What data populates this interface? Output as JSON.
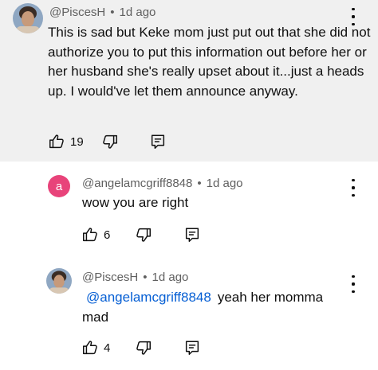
{
  "comments": [
    {
      "author": "@PiscesH",
      "time": "1d ago",
      "text": "This is sad but Keke mom just put out that she did not authorize you to put this information out before her or her husband she's really upset about it...just a heads up. I would've let them announce anyway.",
      "likes": "19",
      "avatar": "photo",
      "highlighted": true
    },
    {
      "author": "@angelamcgriff8848",
      "time": "1d ago",
      "text": "wow you are right",
      "likes": "6",
      "avatar": "letter",
      "avatar_letter": "a",
      "avatar_color": "#e8437a"
    },
    {
      "author": "@PiscesH",
      "time": "1d ago",
      "mention": "@angelamcgriff8848",
      "text": "yeah her momma mad",
      "likes": "4",
      "avatar": "photo"
    }
  ],
  "meta_separator": "•",
  "colors": {
    "highlight_bg": "#f0f0f0",
    "mention": "#065fd4",
    "secondary_text": "#606060"
  },
  "icons": [
    "thumbs-up-icon",
    "thumbs-down-icon",
    "reply-icon",
    "more-vert-icon"
  ]
}
